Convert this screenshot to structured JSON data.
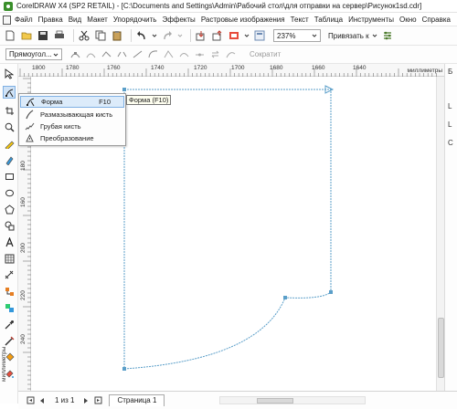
{
  "title_bar": {
    "title": "CorelDRAW X4 (SP2 RETAIL) - [C:\\Documents and Settings\\Admin\\Рабочий стол\\для отправки на сервер\\Рисунок1sd.cdr]"
  },
  "menu": [
    "Файл",
    "Правка",
    "Вид",
    "Макет",
    "Упорядочить",
    "Эффекты",
    "Растровые изображения",
    "Текст",
    "Таблица",
    "Инструменты",
    "Окно",
    "Справка"
  ],
  "toolbar": {
    "zoom_value": "237%",
    "snap_label": "Привязать к"
  },
  "property_bar": {
    "shape_select_value": "Прямоугол...",
    "reduce_label": "Сократит"
  },
  "ruler": {
    "h_labels": [
      "1800",
      "1780",
      "1760",
      "1740",
      "1720",
      "1700",
      "1680",
      "1660",
      "1640"
    ],
    "unit": "миллиметры",
    "v_labels": [
      "180",
      "160",
      "200",
      "220",
      "240"
    ]
  },
  "flyout": {
    "items": [
      {
        "label": "Форма",
        "shortcut": "F10",
        "icon": "shape-tool-icon"
      },
      {
        "label": "Размазывающая кисть",
        "shortcut": "",
        "icon": "smudge-brush-icon"
      },
      {
        "label": "Грубая кисть",
        "shortcut": "",
        "icon": "roughen-brush-icon"
      },
      {
        "label": "Преобразование",
        "shortcut": "",
        "icon": "transform-icon"
      }
    ],
    "tooltip": "Форма (F10)"
  },
  "page_nav": {
    "count": "1 из 1",
    "page_tab": "Страница 1"
  },
  "right_strip": {
    "letters": [
      "Б",
      "L",
      "L",
      "C"
    ]
  },
  "colors": {
    "selection_bg": "#dcebfa",
    "selection_border": "#7fb0e3",
    "shape_outline": "#5b9fc9",
    "node": "#5b9fc9"
  }
}
